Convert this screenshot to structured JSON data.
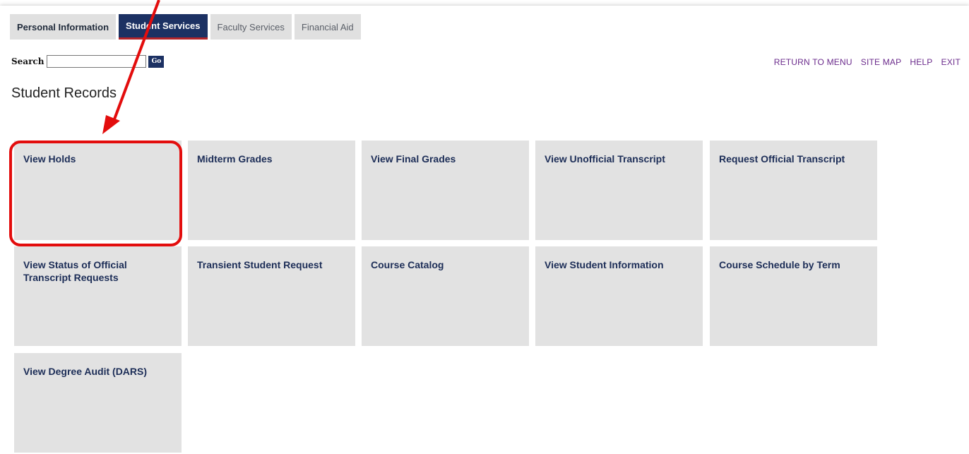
{
  "tabs": [
    {
      "label": "Personal Information"
    },
    {
      "label": "Student Services"
    },
    {
      "label": "Faculty Services"
    },
    {
      "label": "Financial Aid"
    }
  ],
  "search": {
    "label": "Search",
    "value": "",
    "go_label": "Go"
  },
  "top_links": [
    {
      "label": "RETURN TO MENU"
    },
    {
      "label": "SITE MAP"
    },
    {
      "label": "HELP"
    },
    {
      "label": "EXIT"
    }
  ],
  "section_title": "Student Records",
  "tiles": [
    {
      "label": "View Holds"
    },
    {
      "label": "Midterm Grades"
    },
    {
      "label": "View Final Grades"
    },
    {
      "label": "View Unofficial Transcript"
    },
    {
      "label": "Request Official Transcript"
    },
    {
      "label": "View Status of Official Transcript Requests"
    },
    {
      "label": "Transient Student Request"
    },
    {
      "label": "Course Catalog"
    },
    {
      "label": "View Student Information"
    },
    {
      "label": "Course Schedule by Term"
    },
    {
      "label": "View Degree Audit (DARS)"
    }
  ],
  "colors": {
    "active_tab": "#1c3163",
    "active_tab_underline": "#b3252a",
    "tile_background": "#e2e2e2",
    "tile_text": "#1c2d57",
    "link_color": "#6b2b8c",
    "annotation_red": "#e30d0d"
  },
  "annotation": {
    "type": "red-arrow",
    "target": "View Holds"
  }
}
